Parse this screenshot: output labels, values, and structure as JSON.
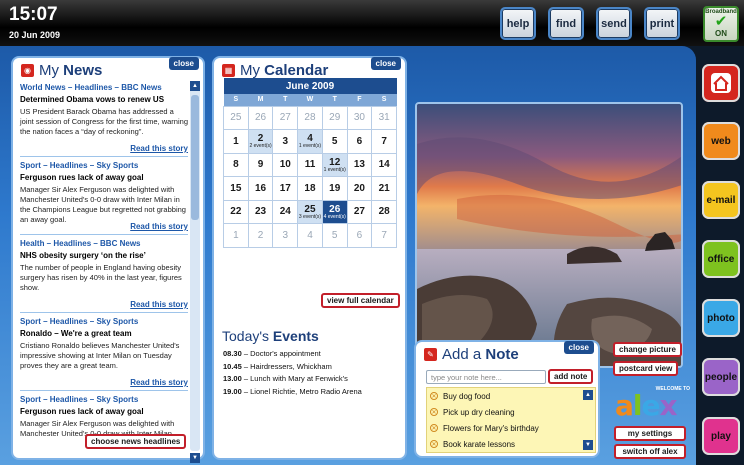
{
  "clock": {
    "time": "15:07",
    "date": "20 Jun 2009"
  },
  "top_buttons": [
    {
      "label": "help",
      "icon": "none"
    },
    {
      "label": "find",
      "icon": "none"
    },
    {
      "label": "send",
      "icon": "none"
    },
    {
      "label": "print",
      "icon": "none"
    }
  ],
  "broadband": {
    "label": "Broadband",
    "status": "ON",
    "icon": "check-icon",
    "color": "#21a318"
  },
  "news": {
    "title_prefix": "My",
    "title_main": "News",
    "close": "close",
    "items": [
      {
        "category": "World News – Headlines – BBC News",
        "headline": "Determined Obama vows to renew US",
        "body": "US President Barack Obama has addressed a joint session of Congress for the first time, warning the nation faces a “day of reckoning”.",
        "link": "Read this story"
      },
      {
        "category": "Sport – Headlines – Sky Sports",
        "headline": "Ferguson rues lack of away goal",
        "body": "Manager Sir Alex Ferguson was delighted with Manchester United's 0-0 draw with Inter Milan in the Champions League but regretted not grabbing an away goal.",
        "link": "Read this story"
      },
      {
        "category": "Health – Headlines – BBC News",
        "headline": "NHS obesity surgery ‘on the rise’",
        "body": "The number of people in England having obesity surgery has risen by 40% in the last year, figures show.",
        "link": "Read this story"
      },
      {
        "category": "Sport – Headlines – Sky Sports",
        "headline": "Ronaldo – We're a great team",
        "body": "Cristiano Ronaldo believes Manchester United's impressive showing at Inter Milan on Tuesday proves they are a great team.",
        "link": "Read this story"
      },
      {
        "category": "Sport – Headlines – Sky Sports",
        "headline": "Ferguson rues lack of away goal",
        "body": "Manager Sir Alex Ferguson was delighted with Manchester United's 0-0 draw with Inter Milan",
        "link": ""
      }
    ],
    "choose_button": "choose news headlines"
  },
  "calendar": {
    "title_prefix": "My",
    "title_main": "Calendar",
    "close": "close",
    "month": "June 2009",
    "dow": [
      "S",
      "M",
      "T",
      "W",
      "T",
      "F",
      "S"
    ],
    "weeks": [
      [
        {
          "d": "25",
          "m": true
        },
        {
          "d": "26",
          "m": true
        },
        {
          "d": "27",
          "m": true
        },
        {
          "d": "28",
          "m": true
        },
        {
          "d": "29",
          "m": true
        },
        {
          "d": "30",
          "m": true
        },
        {
          "d": "31",
          "m": true
        }
      ],
      [
        {
          "d": "1"
        },
        {
          "d": "2",
          "e": "2 event(s)"
        },
        {
          "d": "3"
        },
        {
          "d": "4",
          "e": "1 event(s)"
        },
        {
          "d": "5"
        },
        {
          "d": "6"
        },
        {
          "d": "7"
        }
      ],
      [
        {
          "d": "8"
        },
        {
          "d": "9"
        },
        {
          "d": "10"
        },
        {
          "d": "11"
        },
        {
          "d": "12",
          "e": "1 event(s)"
        },
        {
          "d": "13"
        },
        {
          "d": "14"
        }
      ],
      [
        {
          "d": "15"
        },
        {
          "d": "16"
        },
        {
          "d": "17"
        },
        {
          "d": "18"
        },
        {
          "d": "19"
        },
        {
          "d": "20"
        },
        {
          "d": "21"
        }
      ],
      [
        {
          "d": "22"
        },
        {
          "d": "23"
        },
        {
          "d": "24"
        },
        {
          "d": "25",
          "e": "3 event(s)"
        },
        {
          "d": "26",
          "e": "4 event(s)",
          "t": true
        },
        {
          "d": "27"
        },
        {
          "d": "28"
        }
      ],
      [
        {
          "d": "1",
          "m": true
        },
        {
          "d": "2",
          "m": true
        },
        {
          "d": "3",
          "m": true
        },
        {
          "d": "4",
          "m": true
        },
        {
          "d": "5",
          "m": true
        },
        {
          "d": "6",
          "m": true
        },
        {
          "d": "7",
          "m": true
        }
      ]
    ],
    "view_full": "view full calendar",
    "events_title_prefix": "Today's",
    "events_title_main": "Events",
    "events": [
      {
        "time": "08.30",
        "text": "– Doctor's appointment"
      },
      {
        "time": "10.45",
        "text": "– Hairdressers, Whickham"
      },
      {
        "time": "13.00",
        "text": "– Lunch with Mary at Fenwick's"
      },
      {
        "time": "19.00",
        "text": "– Lionel Richtie, Metro Radio Arena"
      }
    ]
  },
  "photo": {
    "change": "change picture",
    "postcard": "postcard view"
  },
  "note": {
    "title_prefix": "Add a",
    "title_main": "Note",
    "close": "close",
    "placeholder": "type your note here...",
    "add": "add note",
    "items": [
      "Buy dog food",
      "Pick up dry cleaning",
      "Flowers for Mary's birthday",
      "Book karate lessons"
    ]
  },
  "tiles": [
    {
      "label": "",
      "icon": "home-icon",
      "color": "#d4261e"
    },
    {
      "label": "web",
      "color": "#f08a1c"
    },
    {
      "label": "e-mail",
      "color": "#f4c51f"
    },
    {
      "label": "office",
      "color": "#7ec21f"
    },
    {
      "label": "photo",
      "color": "#3aa8e6"
    },
    {
      "label": "people",
      "color": "#9a64c8"
    },
    {
      "label": "play",
      "color": "#e0328e"
    }
  ],
  "alex": {
    "welcome": "WELCOME TO",
    "word": "alex",
    "settings": "my settings",
    "switch_off": "switch off alex"
  }
}
